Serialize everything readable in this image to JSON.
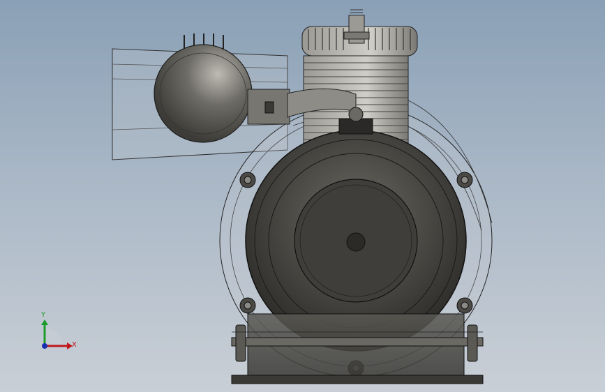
{
  "triad": {
    "x_label": "X",
    "y_label": "Y",
    "x_color": "#c0161c",
    "y_color": "#1c9a2a",
    "z_color": "#1a2fb0"
  },
  "model": {
    "body_color": "#4b4a46",
    "edge_color": "#111111",
    "glass_color": "#b9c2cc"
  }
}
